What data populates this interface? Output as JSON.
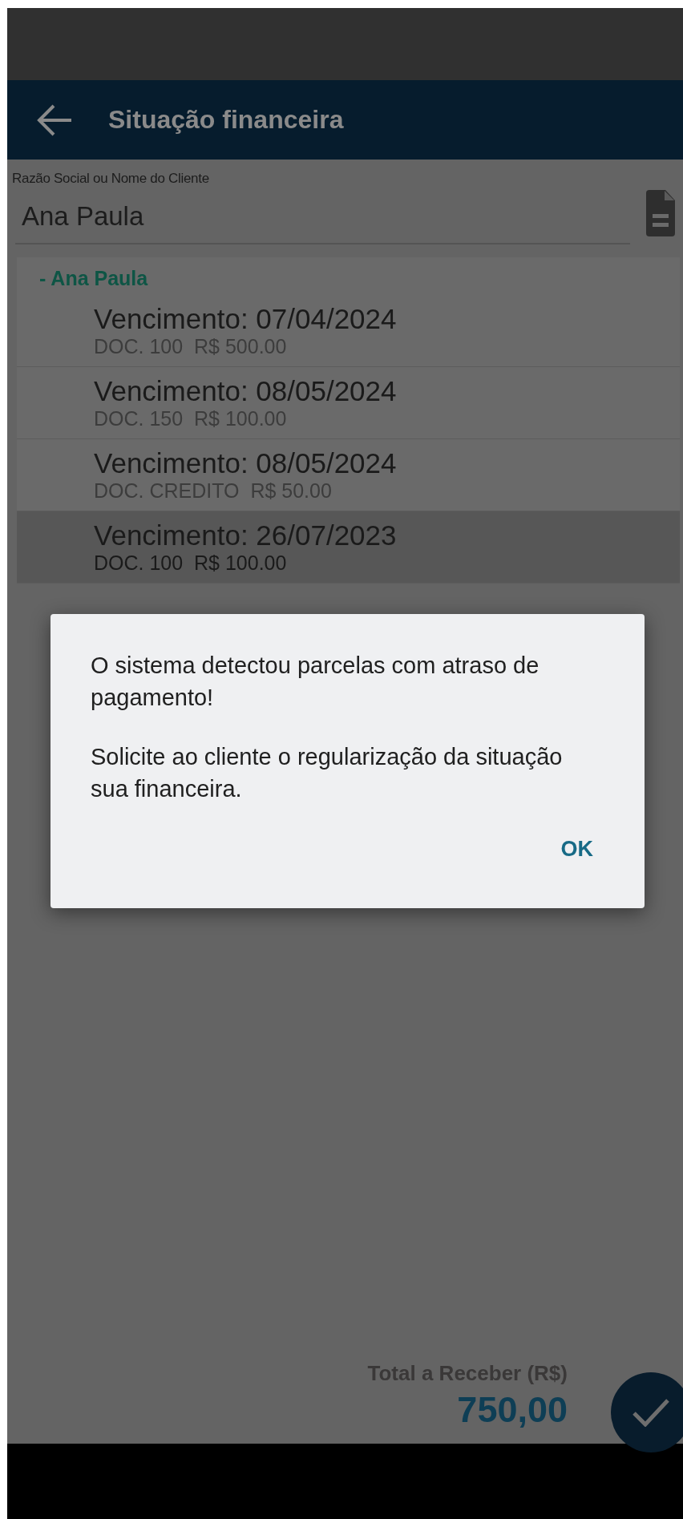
{
  "header": {
    "title": "Situação financeira"
  },
  "client_field": {
    "label": "Razão Social ou Nome do Cliente",
    "value": "Ana Paula"
  },
  "group": {
    "title": "- Ana Paula",
    "rows": [
      {
        "title": "Vencimento: 07/04/2024",
        "detail": "DOC. 100  R$ 500.00",
        "selected": false
      },
      {
        "title": "Vencimento: 08/05/2024",
        "detail": "DOC. 150  R$ 100.00",
        "selected": false
      },
      {
        "title": "Vencimento: 08/05/2024",
        "detail": "DOC. CREDITO  R$ 50.00",
        "selected": false
      },
      {
        "title": "Vencimento: 26/07/2023",
        "detail": "DOC. 100  R$ 100.00",
        "selected": true
      }
    ]
  },
  "dialog": {
    "paragraphs": [
      "O sistema detectou parcelas com atraso de pagamento!",
      "Solicite ao cliente o regularização da situação sua financeira."
    ],
    "button": "OK"
  },
  "total": {
    "label": "Total a Receber (R$)",
    "value": "750,00"
  }
}
